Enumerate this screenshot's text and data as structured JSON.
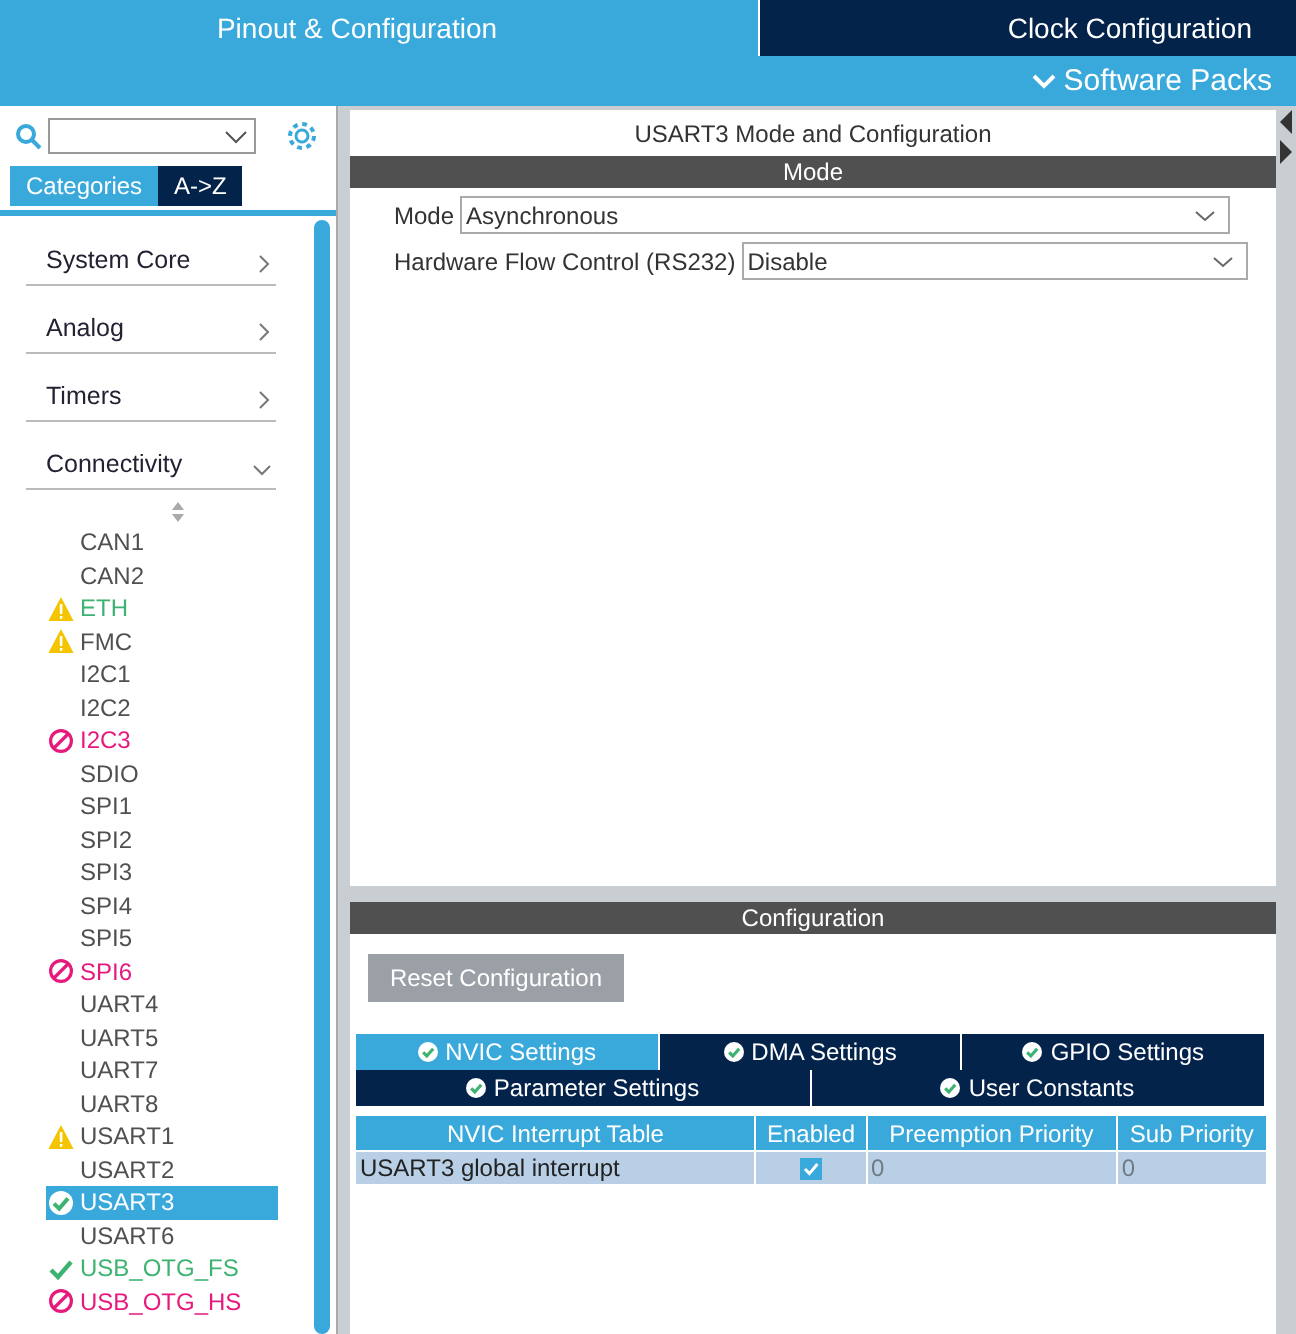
{
  "top_tabs": [
    {
      "label": "Pinout & Configuration",
      "selected": true
    },
    {
      "label": "Clock Configuration",
      "selected": false
    }
  ],
  "software_packs": {
    "label": "Software Packs"
  },
  "sidebar": {
    "view_tabs": [
      {
        "label": "Categories",
        "selected": true
      },
      {
        "label": "A->Z",
        "selected": false
      }
    ],
    "categories": [
      {
        "label": "System Core",
        "expanded": false
      },
      {
        "label": "Analog",
        "expanded": false
      },
      {
        "label": "Timers",
        "expanded": false
      },
      {
        "label": "Connectivity",
        "expanded": true
      }
    ],
    "peripherals": [
      {
        "label": "CAN1",
        "kind": "plain",
        "color": "#505050",
        "selected": false
      },
      {
        "label": "CAN2",
        "kind": "plain",
        "color": "#505050",
        "selected": false
      },
      {
        "label": "ETH",
        "kind": "warning",
        "color": "#3cb371",
        "selected": false
      },
      {
        "label": "FMC",
        "kind": "warning",
        "color": "#505050",
        "selected": false
      },
      {
        "label": "I2C1",
        "kind": "plain",
        "color": "#505050",
        "selected": false
      },
      {
        "label": "I2C2",
        "kind": "plain",
        "color": "#505050",
        "selected": false
      },
      {
        "label": "I2C3",
        "kind": "blocked",
        "color": "#e6197d",
        "selected": false
      },
      {
        "label": "SDIO",
        "kind": "plain",
        "color": "#505050",
        "selected": false
      },
      {
        "label": "SPI1",
        "kind": "plain",
        "color": "#505050",
        "selected": false
      },
      {
        "label": "SPI2",
        "kind": "plain",
        "color": "#505050",
        "selected": false
      },
      {
        "label": "SPI3",
        "kind": "plain",
        "color": "#505050",
        "selected": false
      },
      {
        "label": "SPI4",
        "kind": "plain",
        "color": "#505050",
        "selected": false
      },
      {
        "label": "SPI5",
        "kind": "plain",
        "color": "#505050",
        "selected": false
      },
      {
        "label": "SPI6",
        "kind": "blocked",
        "color": "#e6197d",
        "selected": false
      },
      {
        "label": "UART4",
        "kind": "plain",
        "color": "#505050",
        "selected": false
      },
      {
        "label": "UART5",
        "kind": "plain",
        "color": "#505050",
        "selected": false
      },
      {
        "label": "UART7",
        "kind": "plain",
        "color": "#505050",
        "selected": false
      },
      {
        "label": "UART8",
        "kind": "plain",
        "color": "#505050",
        "selected": false
      },
      {
        "label": "USART1",
        "kind": "warning",
        "color": "#505050",
        "selected": false
      },
      {
        "label": "USART2",
        "kind": "plain",
        "color": "#505050",
        "selected": false
      },
      {
        "label": "USART3",
        "kind": "ok",
        "color": "#ffffff",
        "selected": true
      },
      {
        "label": "USART6",
        "kind": "plain",
        "color": "#505050",
        "selected": false
      },
      {
        "label": "USB_OTG_FS",
        "kind": "ok",
        "color": "#3cb371",
        "selected": false
      },
      {
        "label": "USB_OTG_HS",
        "kind": "blocked",
        "color": "#e6197d",
        "selected": false
      }
    ]
  },
  "mode_panel": {
    "title": "USART3 Mode and Configuration",
    "header": "Mode",
    "fields": [
      {
        "label": "Mode",
        "value": "Asynchronous"
      },
      {
        "label": "Hardware Flow Control (RS232)",
        "value": "Disable"
      }
    ]
  },
  "config_panel": {
    "header": "Configuration",
    "reset_button": "Reset Configuration",
    "tab_rows": [
      [
        {
          "label": "NVIC Settings",
          "selected": true
        },
        {
          "label": "DMA Settings",
          "selected": false
        },
        {
          "label": "GPIO Settings",
          "selected": false
        }
      ],
      [
        {
          "label": "Parameter Settings",
          "selected": false
        },
        {
          "label": "User Constants",
          "selected": false
        }
      ]
    ],
    "table": {
      "columns": [
        "NVIC Interrupt Table",
        "Enabled",
        "Preemption Priority",
        "Sub Priority"
      ],
      "rows": [
        {
          "name": "USART3 global interrupt",
          "enabled": true,
          "preemption": "0",
          "sub": "0"
        }
      ]
    }
  }
}
